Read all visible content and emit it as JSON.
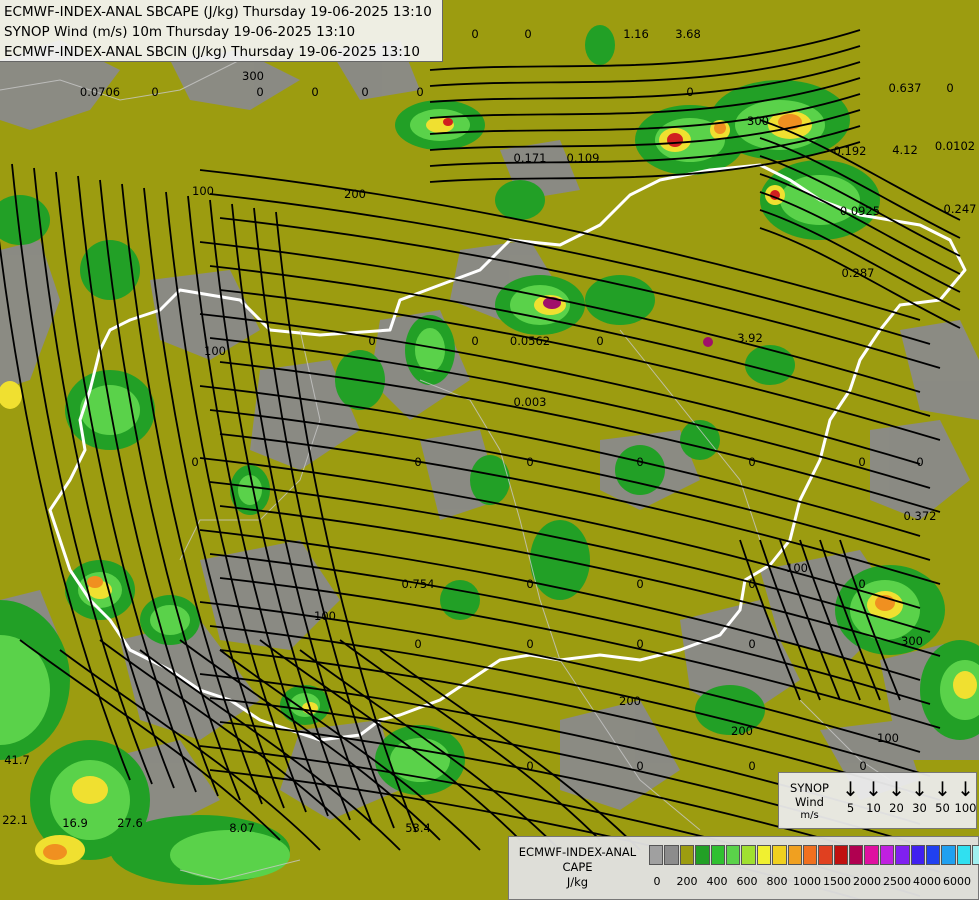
{
  "title_lines": [
    "ECMWF-INDEX-ANAL SBCAPE (J/kg) Thursday 19-06-2025 13:10",
    "SYNOP Wind (m/s) 10m Thursday 19-06-2025 13:10",
    "ECMWF-INDEX-ANAL SBCIN (J/kg) Thursday 19-06-2025 13:10"
  ],
  "colors": {
    "background_low_cape": "#9c9c10",
    "dark_grey_terrain": "#8a8a8a",
    "green_light": "#5ad24a",
    "green_dark": "#22a026",
    "yellow": "#f0e030",
    "orange": "#f09020",
    "red": "#d02020",
    "magenta": "#a0106a",
    "border_country": "#ffffff",
    "streamline": "#000000"
  },
  "synop_legend": {
    "title": "SYNOP",
    "subtitle": "Wind",
    "unit": "m/s",
    "arrows": [
      "5",
      "10",
      "20",
      "30",
      "50",
      "100"
    ]
  },
  "cape_legend": {
    "title": "ECMWF-INDEX-ANAL",
    "subtitle": "CAPE",
    "unit": "J/kg",
    "swatch_colors": [
      "#a0a0a0",
      "#8c8c8c",
      "#9c9c10",
      "#22a026",
      "#30c030",
      "#5ad24a",
      "#a0e030",
      "#f0f030",
      "#f0d020",
      "#f0a020",
      "#f07020",
      "#e04020",
      "#c01010",
      "#b00050",
      "#e010a0",
      "#c020e0",
      "#8020f0",
      "#4020f0",
      "#2040f0",
      "#20a0f0",
      "#30e0f0",
      "#a0f0f0",
      "#ffffff"
    ],
    "ticks": [
      "0",
      "200",
      "400",
      "600",
      "800",
      "1000",
      "1500",
      "2000",
      "2500",
      "4000",
      "6000"
    ]
  },
  "map_labels": [
    {
      "text": "0.0706"
    },
    {
      "text": "0"
    },
    {
      "text": "0"
    },
    {
      "text": "0"
    },
    {
      "text": "0"
    },
    {
      "text": "0"
    },
    {
      "text": "1.16"
    },
    {
      "text": "3.68"
    },
    {
      "text": "0"
    },
    {
      "text": "0"
    },
    {
      "text": "0"
    },
    {
      "text": "0.637"
    },
    {
      "text": "0"
    },
    {
      "text": "0.171"
    },
    {
      "text": "0.109"
    },
    {
      "text": "4.12"
    },
    {
      "text": "0.0102"
    },
    {
      "text": "0.192"
    },
    {
      "text": "0.0925"
    },
    {
      "text": "0.247"
    },
    {
      "text": "0.287"
    },
    {
      "text": "0"
    },
    {
      "text": "0"
    },
    {
      "text": "0"
    },
    {
      "text": "0.0562"
    },
    {
      "text": "3.92"
    },
    {
      "text": "0.003"
    },
    {
      "text": "0"
    },
    {
      "text": "0"
    },
    {
      "text": "0"
    },
    {
      "text": "0"
    },
    {
      "text": "0"
    },
    {
      "text": "0"
    },
    {
      "text": "0.372"
    },
    {
      "text": "0"
    },
    {
      "text": "0.754"
    },
    {
      "text": "0"
    },
    {
      "text": "0"
    },
    {
      "text": "0"
    },
    {
      "text": "0"
    },
    {
      "text": "0"
    },
    {
      "text": "0"
    },
    {
      "text": "0"
    },
    {
      "text": "0"
    },
    {
      "text": "41.7"
    },
    {
      "text": "22.1"
    },
    {
      "text": "16.9"
    },
    {
      "text": "27.6"
    },
    {
      "text": "8.07"
    },
    {
      "text": "53.4"
    },
    {
      "text": "0"
    },
    {
      "text": "0"
    },
    {
      "text": "0"
    },
    {
      "text": "0"
    },
    {
      "text": "100"
    },
    {
      "text": "100"
    },
    {
      "text": "200"
    },
    {
      "text": "300"
    },
    {
      "text": "100"
    },
    {
      "text": "200"
    },
    {
      "text": "300"
    },
    {
      "text": "300"
    },
    {
      "text": "200"
    },
    {
      "text": "100"
    },
    {
      "text": "100"
    }
  ]
}
